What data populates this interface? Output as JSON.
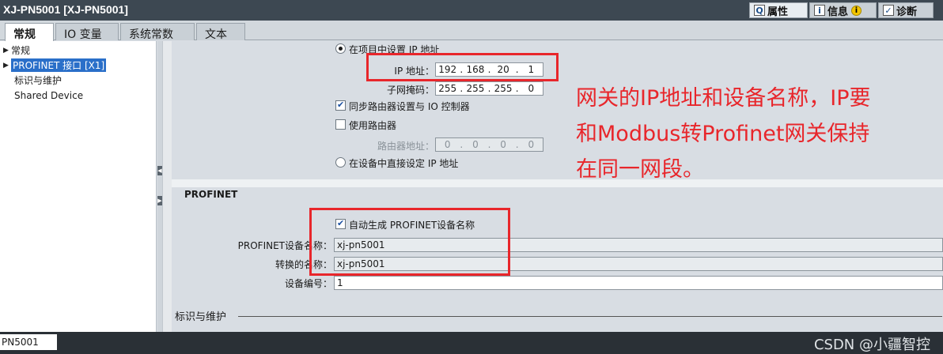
{
  "window": {
    "title": "XJ-PN5001 [XJ-PN5001]"
  },
  "inspector_tabs": {
    "properties": "属性",
    "info": "信息",
    "diagnostics": "诊断"
  },
  "category_tabs": {
    "general": "常规",
    "io_variables": "IO 变量",
    "system_constants": "系统常数",
    "text": "文本"
  },
  "tree": {
    "items": [
      {
        "label": "常规"
      },
      {
        "label": "PROFINET 接口 [X1]"
      },
      {
        "label": "标识与维护"
      },
      {
        "label": "Shared Device"
      }
    ]
  },
  "ip_protocol": {
    "set_in_project_label": "在项目中设置 IP 地址",
    "ip_label": "IP 地址：",
    "ip": [
      "192",
      "168",
      "20",
      "1"
    ],
    "subnet_label": "子网掩码：",
    "subnet": [
      "255",
      "255",
      "255",
      "0"
    ],
    "sync_router_label": "同步路由器设置与 IO 控制器",
    "use_router_label": "使用路由器",
    "router_address_label": "路由器地址：",
    "router": [
      "0",
      "0",
      "0",
      "0"
    ],
    "set_on_device_label": "在设备中直接设定 IP 地址"
  },
  "profinet": {
    "section_title": "PROFINET",
    "auto_generate_label": "自动生成 PROFINET设备名称",
    "device_name_label": "PROFINET设备名称：",
    "device_name_value": "xj-pn5001",
    "converted_name_label": "转换的名称：",
    "converted_name_value": "xj-pn5001",
    "device_number_label": "设备编号：",
    "device_number_value": "1"
  },
  "maintenance": {
    "section_title": "标识与维护"
  },
  "annotation": {
    "lines": [
      "网关的IP地址和设备名称，IP要",
      "和Modbus转Profinet网关保持",
      "在同一网段。"
    ],
    "color": "#e8262b"
  },
  "statusbar": {
    "tab_label": "PN5001"
  },
  "watermark": "CSDN @小疆智控"
}
